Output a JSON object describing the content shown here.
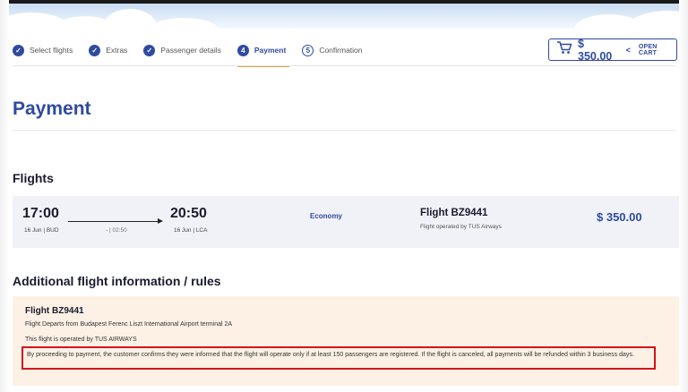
{
  "steps": [
    {
      "label": "Select flights",
      "state": "done",
      "icon": "check-icon"
    },
    {
      "label": "Extras",
      "state": "done",
      "icon": "check-icon"
    },
    {
      "label": "Passenger details",
      "state": "done",
      "icon": "check-icon"
    },
    {
      "label": "Payment",
      "state": "active",
      "number": "4"
    },
    {
      "label": "Confirmation",
      "state": "pending",
      "number": "5"
    }
  ],
  "cart": {
    "amount": "$ 350.00",
    "chevron": "<",
    "open_label": "OPEN CART",
    "icon": "cart-icon"
  },
  "page_title": "Payment",
  "flights_heading": "Flights",
  "flight": {
    "depart_time": "17:00",
    "depart_info": "16 Jun | BUD",
    "duration": "- | 02:50",
    "arrive_time": "20:50",
    "arrive_info": "16 Jun | LCA",
    "fare_class": "Economy",
    "flight_number": "Flight BZ9441",
    "operated_by": "Flight operated by TUS Airways",
    "price": "$ 350.00"
  },
  "additional": {
    "heading": "Additional flight information / rules",
    "flight_title": "Flight BZ9441",
    "departs_from": "Flight Departs from Budapest Ferenc Liszt International Airport terminal 2A",
    "operator_line": "This flight is operated by TUS AIRWAYS",
    "notice": "By proceeding to payment, the customer confirms they were informed that the flight will operate only if at least 150 passengers are registered. If the flight is canceled, all payments will be refunded within 3 business days."
  },
  "colors": {
    "accent": "#2f4aa0",
    "highlight": "#d4141b",
    "info_bg": "#fdf1e6",
    "card_bg": "#f1f2f7",
    "tab_underline": "#e0a84a"
  }
}
